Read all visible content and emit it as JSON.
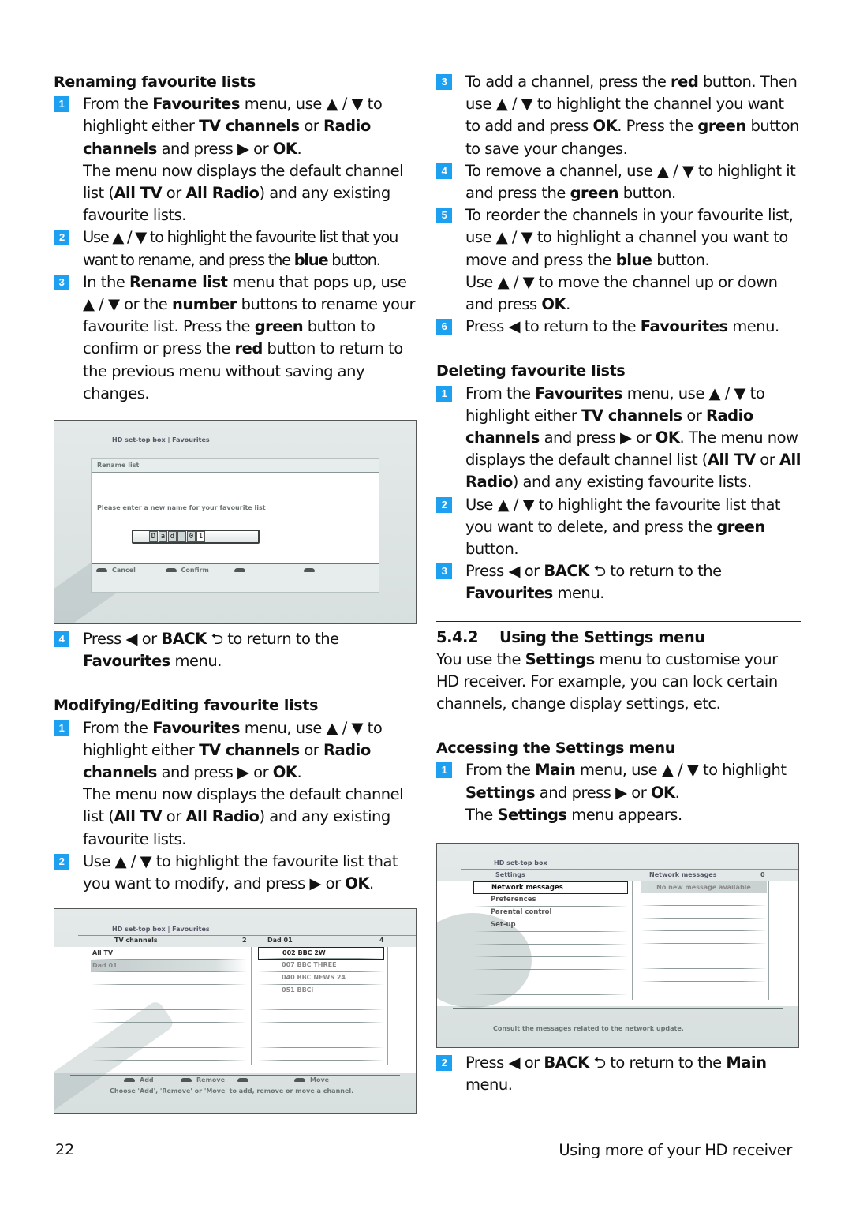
{
  "left": {
    "renaming": {
      "heading": "Renaming favourite lists",
      "steps": [
        {
          "num": "1",
          "parts": [
            {
              "t": "From the "
            },
            {
              "b": "Favourites"
            },
            {
              "t": " menu, use ▲ / ▼ to highlight either "
            },
            {
              "b": "TV channels"
            },
            {
              "t": " or "
            },
            {
              "b": "Radio channels"
            },
            {
              "t": " and press ▶ or "
            },
            {
              "b": "OK"
            },
            {
              "t": "."
            }
          ],
          "extra": [
            {
              "t": "The menu now displays the default channel list ("
            },
            {
              "b": "All TV"
            },
            {
              "t": " or "
            },
            {
              "b": "All Radio"
            },
            {
              "t": ") and any existing favourite lists."
            }
          ]
        },
        {
          "num": "2",
          "condensed": true,
          "parts": [
            {
              "t": "Use ▲ / ▼ to highlight the favourite list that you want to rename, and press the "
            },
            {
              "b": "blue"
            },
            {
              "t": " button."
            }
          ]
        },
        {
          "num": "3",
          "parts": [
            {
              "t": "In the "
            },
            {
              "b": "Rename list"
            },
            {
              "t": " menu that pops up, use ▲ / ▼ or the "
            },
            {
              "b": "number"
            },
            {
              "t": " buttons to rename your favourite list. Press the "
            },
            {
              "b": "green"
            },
            {
              "t": " button to confirm or press the "
            },
            {
              "b": "red"
            },
            {
              "t": " button to return to the previous menu without saving any changes."
            }
          ]
        }
      ]
    },
    "rename_screen": {
      "breadcrumb": "HD set-top box | Favourites",
      "dialog_title": "Rename list",
      "prompt": "Please enter a new name for your favourite list",
      "name_chars": [
        "D",
        "a",
        "d",
        " ",
        "0",
        "1"
      ],
      "keys": [
        "Cancel",
        "Confirm",
        "",
        ""
      ]
    },
    "step4": {
      "num": "4",
      "parts": [
        {
          "t": "Press ◀ or "
        },
        {
          "b": "BACK"
        },
        {
          "t": " ⮌ to return to the "
        },
        {
          "b": "Favourites"
        },
        {
          "t": " menu."
        }
      ]
    },
    "modifying": {
      "heading": "Modifying/Editing favourite lists",
      "steps": [
        {
          "num": "1",
          "parts": [
            {
              "t": "From the "
            },
            {
              "b": "Favourites"
            },
            {
              "t": " menu, use ▲ / ▼ to highlight either "
            },
            {
              "b": "TV channels"
            },
            {
              "t": " or "
            },
            {
              "b": "Radio channels"
            },
            {
              "t": " and press ▶ or "
            },
            {
              "b": "OK"
            },
            {
              "t": "."
            }
          ],
          "extra": [
            {
              "t": "The menu now displays the default channel list ("
            },
            {
              "b": "All TV"
            },
            {
              "t": " or "
            },
            {
              "b": "All Radio"
            },
            {
              "t": ") and any existing favourite lists."
            }
          ]
        },
        {
          "num": "2",
          "parts": [
            {
              "t": "Use ▲ / ▼ to highlight the favourite list that you want to modify, and press ▶ or "
            },
            {
              "b": "OK"
            },
            {
              "t": "."
            }
          ]
        }
      ]
    },
    "favourites_screen": {
      "breadcrumb": "HD set-top box | Favourites",
      "left_header": "TV channels",
      "left_count": "2",
      "right_header": "Dad 01",
      "right_count": "4",
      "lists": [
        "All TV",
        "Dad 01"
      ],
      "channels": [
        "002 BBC 2W",
        "007 BBC THREE",
        "040 BBC NEWS 24",
        "051 BBCi"
      ],
      "keys": [
        "Add",
        "Remove",
        "",
        "Move"
      ],
      "help": "Choose 'Add', 'Remove' or 'Move' to add, remove or move a channel."
    }
  },
  "right": {
    "steps_cont": [
      {
        "num": "3",
        "parts": [
          {
            "t": "To add a channel, press the "
          },
          {
            "b": "red"
          },
          {
            "t": " button. Then use ▲ / ▼ to highlight the channel you want to add and press "
          },
          {
            "b": "OK"
          },
          {
            "t": ". Press the "
          },
          {
            "b": "green"
          },
          {
            "t": " button to save your changes."
          }
        ]
      },
      {
        "num": "4",
        "parts": [
          {
            "t": "To remove a channel, use ▲ / ▼ to highlight it and press the "
          },
          {
            "b": "green"
          },
          {
            "t": " button."
          }
        ]
      },
      {
        "num": "5",
        "parts": [
          {
            "t": "To reorder the channels in your favourite list, use ▲ / ▼ to highlight a channel you want to move and press the "
          },
          {
            "b": "blue"
          },
          {
            "t": " button."
          }
        ],
        "extra": [
          {
            "t": "Use ▲ / ▼ to move the channel up or down and press "
          },
          {
            "b": "OK"
          },
          {
            "t": "."
          }
        ]
      },
      {
        "num": "6",
        "parts": [
          {
            "t": "Press ◀ to return to the "
          },
          {
            "b": "Favourites"
          },
          {
            "t": " menu."
          }
        ]
      }
    ],
    "deleting": {
      "heading": "Deleting favourite lists",
      "steps": [
        {
          "num": "1",
          "parts": [
            {
              "t": "From the "
            },
            {
              "b": "Favourites"
            },
            {
              "t": " menu, use ▲ / ▼ to highlight either "
            },
            {
              "b": "TV channels"
            },
            {
              "t": " or "
            },
            {
              "b": "Radio channels"
            },
            {
              "t": " and press ▶ or "
            },
            {
              "b": "OK"
            },
            {
              "t": ". The menu now displays the default channel list ("
            },
            {
              "b": "All TV"
            },
            {
              "t": " or "
            },
            {
              "b": "All Radio"
            },
            {
              "t": ") and any existing favourite lists."
            }
          ]
        },
        {
          "num": "2",
          "parts": [
            {
              "t": "Use ▲ / ▼ to highlight the favourite list that you want to delete, and press the "
            },
            {
              "b": "green"
            },
            {
              "t": " button."
            }
          ]
        },
        {
          "num": "3",
          "parts": [
            {
              "t": "Press ◀ or "
            },
            {
              "b": "BACK"
            },
            {
              "t": " ⮌ to return to the "
            },
            {
              "b": "Favourites"
            },
            {
              "t": " menu."
            }
          ]
        }
      ]
    },
    "section": {
      "number": "5.4.2",
      "title": "Using the Settings menu",
      "intro": [
        {
          "t": "You use the "
        },
        {
          "b": "Settings"
        },
        {
          "t": " menu to customise your HD receiver. For example, you can lock certain channels, change display settings, etc."
        }
      ]
    },
    "accessing": {
      "heading": "Accessing the Settings menu",
      "steps": [
        {
          "num": "1",
          "parts": [
            {
              "t": "From the "
            },
            {
              "b": "Main"
            },
            {
              "t": " menu, use ▲ / ▼ to highlight "
            },
            {
              "b": "Settings"
            },
            {
              "t": " and press ▶ or "
            },
            {
              "b": "OK"
            },
            {
              "t": "."
            }
          ],
          "extra": [
            {
              "t": "The "
            },
            {
              "b": "Settings"
            },
            {
              "t": " menu appears."
            }
          ]
        }
      ]
    },
    "settings_screen": {
      "breadcrumb": "HD set-top box",
      "left_header": "Settings",
      "right_header": "Network messages",
      "right_count": "0",
      "items": [
        "Network messages",
        "Preferences",
        "Parental control",
        "Set-up"
      ],
      "right_message": "No new message available",
      "help": "Consult the messages related to the network update."
    },
    "step2": {
      "num": "2",
      "parts": [
        {
          "t": "  Press ◀ or "
        },
        {
          "b": "BACK"
        },
        {
          "t": " ⮌ to return to the "
        },
        {
          "b": "Main"
        },
        {
          "t": " menu."
        }
      ]
    }
  },
  "footer": {
    "page_number": "22",
    "chapter_title": "Using more of your HD receiver"
  },
  "colors": {
    "step_badge": "#1ea0f0"
  }
}
